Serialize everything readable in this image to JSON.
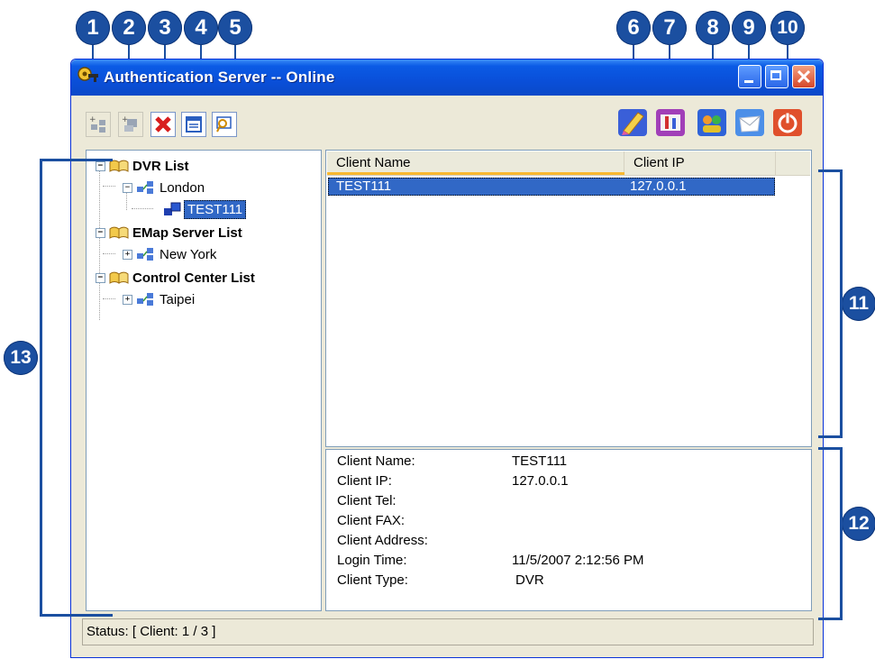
{
  "window": {
    "title": "Authentication Server -- Online"
  },
  "callouts": [
    "1",
    "2",
    "3",
    "4",
    "5",
    "6",
    "7",
    "8",
    "9",
    "10",
    "11",
    "12",
    "13"
  ],
  "tree": {
    "dvr_list": "DVR List",
    "london": "London",
    "test111": "TEST111",
    "emap_list": "EMap Server List",
    "new_york": "New York",
    "control_list": "Control Center List",
    "taipei": "Taipei"
  },
  "client_list": {
    "columns": [
      "Client Name",
      "Client IP"
    ],
    "rows": [
      {
        "name": "TEST111",
        "ip": "127.0.0.1"
      }
    ]
  },
  "details": {
    "name_label": "Client Name:",
    "name_value": "TEST111",
    "ip_label": "Client IP:",
    "ip_value": "127.0.0.1",
    "tel_label": "Client Tel:",
    "fax_label": "Client FAX:",
    "address_label": "Client Address:",
    "login_label": "Login Time:",
    "login_value": "11/5/2007 2:12:56 PM",
    "type_label": "Client Type:",
    "type_value": "DVR"
  },
  "status": {
    "text": "Status: [ Client: 1 / 3 ]"
  },
  "colors": {
    "callout": "#1b4fa0",
    "titlebar": "#0a4fd9",
    "selection": "#3168c6"
  }
}
